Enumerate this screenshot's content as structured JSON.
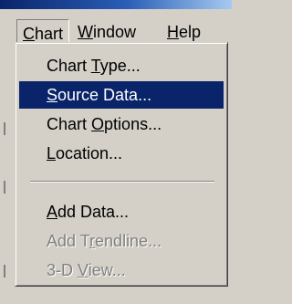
{
  "menubar": {
    "chart": {
      "pre": "",
      "key": "C",
      "post": "hart"
    },
    "window": {
      "pre": "",
      "key": "W",
      "post": "indow"
    },
    "help": {
      "pre": "",
      "key": "H",
      "post": "elp"
    }
  },
  "menu": {
    "items": [
      {
        "pre": "Chart ",
        "key": "T",
        "post": "ype..."
      },
      {
        "pre": "",
        "key": "S",
        "post": "ource Data..."
      },
      {
        "pre": "Chart ",
        "key": "O",
        "post": "ptions..."
      },
      {
        "pre": "",
        "key": "L",
        "post": "ocation..."
      },
      {
        "pre": "",
        "key": "A",
        "post": "dd Data..."
      },
      {
        "pre": "Add T",
        "key": "r",
        "post": "endline..."
      },
      {
        "pre": "3-D ",
        "key": "V",
        "post": "iew..."
      }
    ]
  },
  "colors": {
    "menu_bg": "#d4d0c8",
    "highlight_bg": "#0a246a",
    "highlight_text": "#ffffff",
    "disabled_text": "#808080"
  }
}
